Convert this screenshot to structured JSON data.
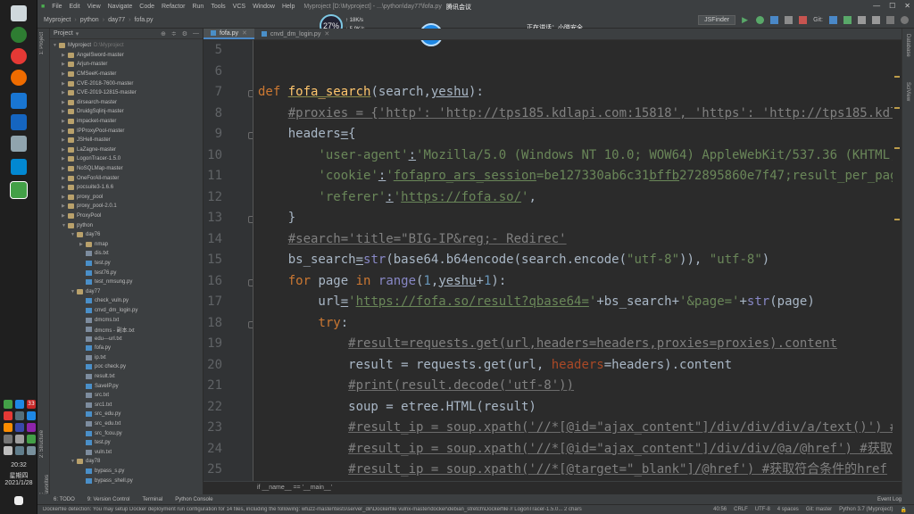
{
  "menubar": {
    "items": [
      "File",
      "Edit",
      "View",
      "Navigate",
      "Code",
      "Refactor",
      "Run",
      "Tools",
      "VCS",
      "Window",
      "Help"
    ],
    "title": "Myproject [D:\\Myproject] - ...\\python\\day77\\fofa.py"
  },
  "meeting": {
    "label": "腾讯会议"
  },
  "speaking": {
    "label": "正在讲话：小晓安全"
  },
  "gauge": {
    "percent": "27%",
    "up": "↑ 18K/s",
    "down": "↓ 5.9K/s"
  },
  "timer": {
    "value": "25:22"
  },
  "breadcrumb": [
    "Myproject",
    "python",
    "day77",
    "fofa.py"
  ],
  "toolbar": {
    "run_config": "JSFinder",
    "git_label": "Git:"
  },
  "project": {
    "header": "Project",
    "tree": [
      {
        "depth": 0,
        "kind": "folder",
        "open": true,
        "name": "Myproject",
        "hint": "D:\\Myproject"
      },
      {
        "depth": 1,
        "kind": "folder",
        "open": false,
        "name": "AngelSword-master"
      },
      {
        "depth": 1,
        "kind": "folder",
        "open": false,
        "name": "Arjun-master"
      },
      {
        "depth": 1,
        "kind": "folder",
        "open": false,
        "name": "CMSeeK-master"
      },
      {
        "depth": 1,
        "kind": "folder",
        "open": false,
        "name": "CVE-2018-7600-master"
      },
      {
        "depth": 1,
        "kind": "folder",
        "open": false,
        "name": "CVE-2019-12815-master"
      },
      {
        "depth": 1,
        "kind": "folder",
        "open": false,
        "name": "dirsearch-master"
      },
      {
        "depth": 1,
        "kind": "folder",
        "open": false,
        "name": "DruidgSqlinj-master"
      },
      {
        "depth": 1,
        "kind": "folder",
        "open": false,
        "name": "impacket-master"
      },
      {
        "depth": 1,
        "kind": "folder",
        "open": false,
        "name": "IPProxyPool-master"
      },
      {
        "depth": 1,
        "kind": "folder",
        "open": false,
        "name": "JSHell-master"
      },
      {
        "depth": 1,
        "kind": "folder",
        "open": false,
        "name": "LaZagne-master"
      },
      {
        "depth": 1,
        "kind": "folder",
        "open": false,
        "name": "LogonTracer-1.5.0"
      },
      {
        "depth": 1,
        "kind": "folder",
        "open": false,
        "name": "NoSQLMap-master"
      },
      {
        "depth": 1,
        "kind": "folder",
        "open": false,
        "name": "OneForAll-master"
      },
      {
        "depth": 1,
        "kind": "folder",
        "open": false,
        "name": "pocsuite3-1.6.6"
      },
      {
        "depth": 1,
        "kind": "folder",
        "open": false,
        "name": "proxy_pool"
      },
      {
        "depth": 1,
        "kind": "folder",
        "open": false,
        "name": "proxy_pool-2.0.1"
      },
      {
        "depth": 1,
        "kind": "folder",
        "open": false,
        "name": "ProxyPool"
      },
      {
        "depth": 1,
        "kind": "folder",
        "open": true,
        "name": "python"
      },
      {
        "depth": 2,
        "kind": "folder",
        "open": true,
        "name": "day76"
      },
      {
        "depth": 3,
        "kind": "folder",
        "open": false,
        "name": "nmap"
      },
      {
        "depth": 3,
        "kind": "file",
        "name": "dis.txt"
      },
      {
        "depth": 3,
        "kind": "py",
        "name": "test.py"
      },
      {
        "depth": 3,
        "kind": "py",
        "name": "test76.py"
      },
      {
        "depth": 3,
        "kind": "py",
        "name": "test_nmsung.py"
      },
      {
        "depth": 2,
        "kind": "folder",
        "open": true,
        "name": "day77"
      },
      {
        "depth": 3,
        "kind": "py",
        "name": "check_vuln.py"
      },
      {
        "depth": 3,
        "kind": "py",
        "name": "cnvd_dm_login.py"
      },
      {
        "depth": 3,
        "kind": "file",
        "name": "dmcms.txt"
      },
      {
        "depth": 3,
        "kind": "file",
        "name": "dmcms - 副本.txt"
      },
      {
        "depth": 3,
        "kind": "file",
        "name": "edu---url.txt"
      },
      {
        "depth": 3,
        "kind": "py",
        "name": "fofa.py"
      },
      {
        "depth": 3,
        "kind": "file",
        "name": "ip.txt"
      },
      {
        "depth": 3,
        "kind": "py",
        "name": "poc check.py"
      },
      {
        "depth": 3,
        "kind": "file",
        "name": "result.txt"
      },
      {
        "depth": 3,
        "kind": "py",
        "name": "SaveIP.py"
      },
      {
        "depth": 3,
        "kind": "file",
        "name": "src.txt"
      },
      {
        "depth": 3,
        "kind": "file",
        "name": "src1.txt"
      },
      {
        "depth": 3,
        "kind": "py",
        "name": "src_edu.py"
      },
      {
        "depth": 3,
        "kind": "file",
        "name": "src_edu.txt"
      },
      {
        "depth": 3,
        "kind": "py",
        "name": "src_fcou.py"
      },
      {
        "depth": 3,
        "kind": "py",
        "name": "test.py"
      },
      {
        "depth": 3,
        "kind": "file",
        "name": "vuln.txt"
      },
      {
        "depth": 2,
        "kind": "folder",
        "open": true,
        "name": "day78"
      },
      {
        "depth": 3,
        "kind": "py",
        "name": "bypass_s.py"
      },
      {
        "depth": 3,
        "kind": "py",
        "name": "bypass_shell.py"
      }
    ]
  },
  "tabs": [
    {
      "label": "fofa.py",
      "active": true
    },
    {
      "label": "cnvd_dm_login.py",
      "active": false
    }
  ],
  "editor": {
    "line_numbers": [
      "5",
      "6",
      "7",
      "8",
      "9",
      "10",
      "11",
      "12",
      "13",
      "14",
      "15",
      "16",
      "17",
      "18",
      "19",
      "20",
      "21",
      "22",
      "23",
      "24",
      "25"
    ],
    "breadcrumb": "if __name__ == '__main__'"
  },
  "left_stripe": [
    "1: Project",
    "2: Structure",
    "2: Favorites"
  ],
  "right_stripe": [
    "Database",
    "SciView"
  ],
  "bottom_tools": [
    "6: TODO",
    "9: Version Control",
    "Terminal",
    "Python Console"
  ],
  "event_log": "Event Log",
  "status": {
    "message": "Dockerfile detection: You may setup Docker deployment run configuration for 14 files, including the following: wfuzz-master\\tests\\server_dir\\Dockerfile vulnx-master\\docker\\debian_stretch\\Dockerfile // LogonTracer-1.5.0... 2 chars",
    "items": [
      "40:56",
      "CRLF",
      "UTF-8",
      "4 spaces",
      "Git: master",
      "Python 3.7 (Myproject)"
    ]
  },
  "taskbar": {
    "time": "20:32",
    "weekday": "星期四",
    "date": "2021/1/28",
    "badge": "33"
  }
}
